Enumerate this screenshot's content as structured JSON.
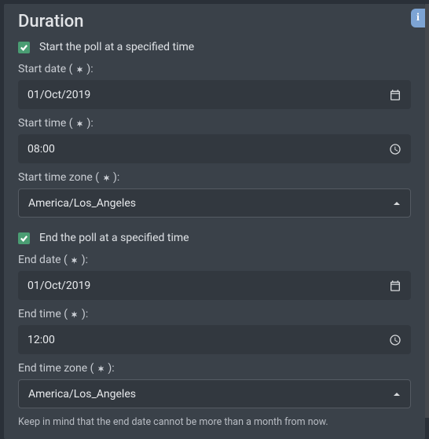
{
  "section": {
    "title": "Duration"
  },
  "start": {
    "checkbox_label": "Start the poll at a specified time",
    "date": {
      "label_prefix": "Start date ( ",
      "label_suffix": " ):",
      "value": "01/Oct/2019"
    },
    "time": {
      "label_prefix": "Start time ( ",
      "label_suffix": " ):",
      "value": "08:00"
    },
    "tz": {
      "label_prefix": "Start time zone ( ",
      "label_suffix": " ):",
      "value": "America/Los_Angeles"
    }
  },
  "end": {
    "checkbox_label": "End the poll at a specified time",
    "date": {
      "label_prefix": "End date ( ",
      "label_suffix": " ):",
      "value": "01/Oct/2019"
    },
    "time": {
      "label_prefix": "End time ( ",
      "label_suffix": " ):",
      "value": "12:00"
    },
    "tz": {
      "label_prefix": "End time zone ( ",
      "label_suffix": " ):",
      "value": "America/Los_Angeles"
    }
  },
  "hint": "Keep in mind that the end date cannot be more than a month from now.",
  "info_badge": "i"
}
